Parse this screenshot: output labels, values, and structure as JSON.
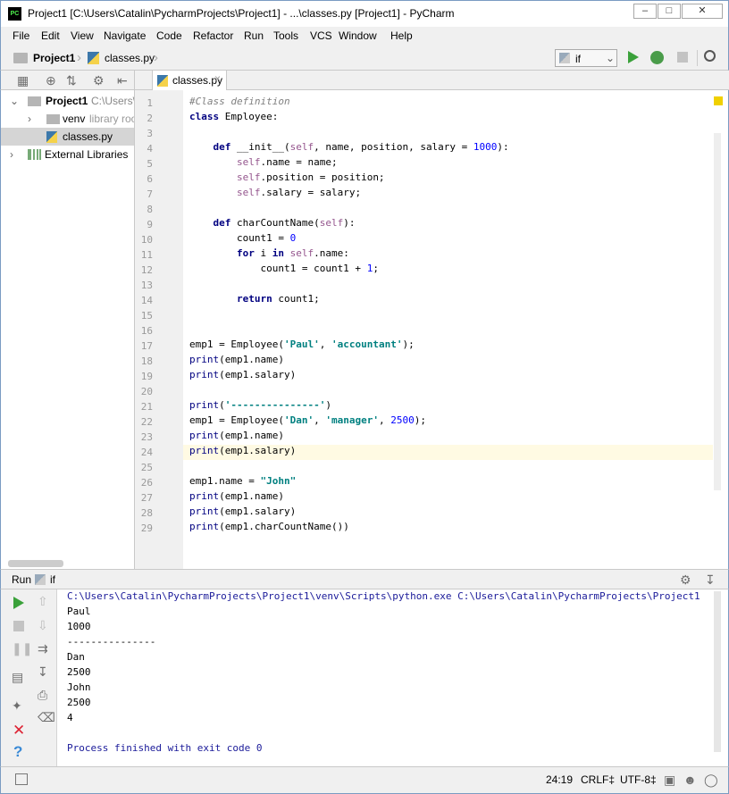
{
  "window": {
    "title": "Project1 [C:\\Users\\Catalin\\PycharmProjects\\Project1] - ...\\classes.py [Project1] - PyCharm"
  },
  "menu": [
    "File",
    "Edit",
    "View",
    "Navigate",
    "Code",
    "Refactor",
    "Run",
    "Tools",
    "VCS",
    "Window",
    "Help"
  ],
  "breadcrumb": {
    "project": "Project1",
    "file": "classes.py"
  },
  "run_config": {
    "selected": "if"
  },
  "tab": {
    "label": "classes.py"
  },
  "tree": {
    "project": "Project1",
    "project_path": "C:\\Users\\",
    "venv": "venv",
    "venv_note": "library roo",
    "file": "classes.py",
    "ext_libs": "External Libraries"
  },
  "code": [
    "#Class definition",
    "class Employee:",
    "",
    "    def __init__(self, name, position, salary = 1000):",
    "        self.name = name;",
    "        self.position = position;",
    "        self.salary = salary;",
    "",
    "    def charCountName(self):",
    "        count1 = 0",
    "        for i in self.name:",
    "            count1 = count1 + 1;",
    "",
    "        return count1;",
    "",
    "",
    "emp1 = Employee('Paul', 'accountant');",
    "print(emp1.name)",
    "print(emp1.salary)",
    "",
    "print('---------------')",
    "emp1 = Employee('Dan', 'manager', 2500);",
    "print(emp1.name)",
    "print(emp1.salary)",
    "",
    "emp1.name = \"John\"",
    "print(emp1.name)",
    "print(emp1.salary)",
    "print(emp1.charCountName())"
  ],
  "run": {
    "title": "Run",
    "config": "if",
    "output": [
      "C:\\Users\\Catalin\\PycharmProjects\\Project1\\venv\\Scripts\\python.exe C:\\Users\\Catalin\\PycharmProjects\\Project1",
      "Paul",
      "1000",
      "---------------",
      "Dan",
      "2500",
      "John",
      "2500",
      "4",
      "",
      "Process finished with exit code 0"
    ]
  },
  "status": {
    "position": "24:19",
    "line_sep": "CRLF‡",
    "encoding": "UTF-8‡"
  },
  "colors": {
    "keyword": "#000080",
    "string": "#008080",
    "number": "#0000ff",
    "self": "#94558d",
    "comment": "#808080",
    "caret_line": "#fffae3"
  }
}
